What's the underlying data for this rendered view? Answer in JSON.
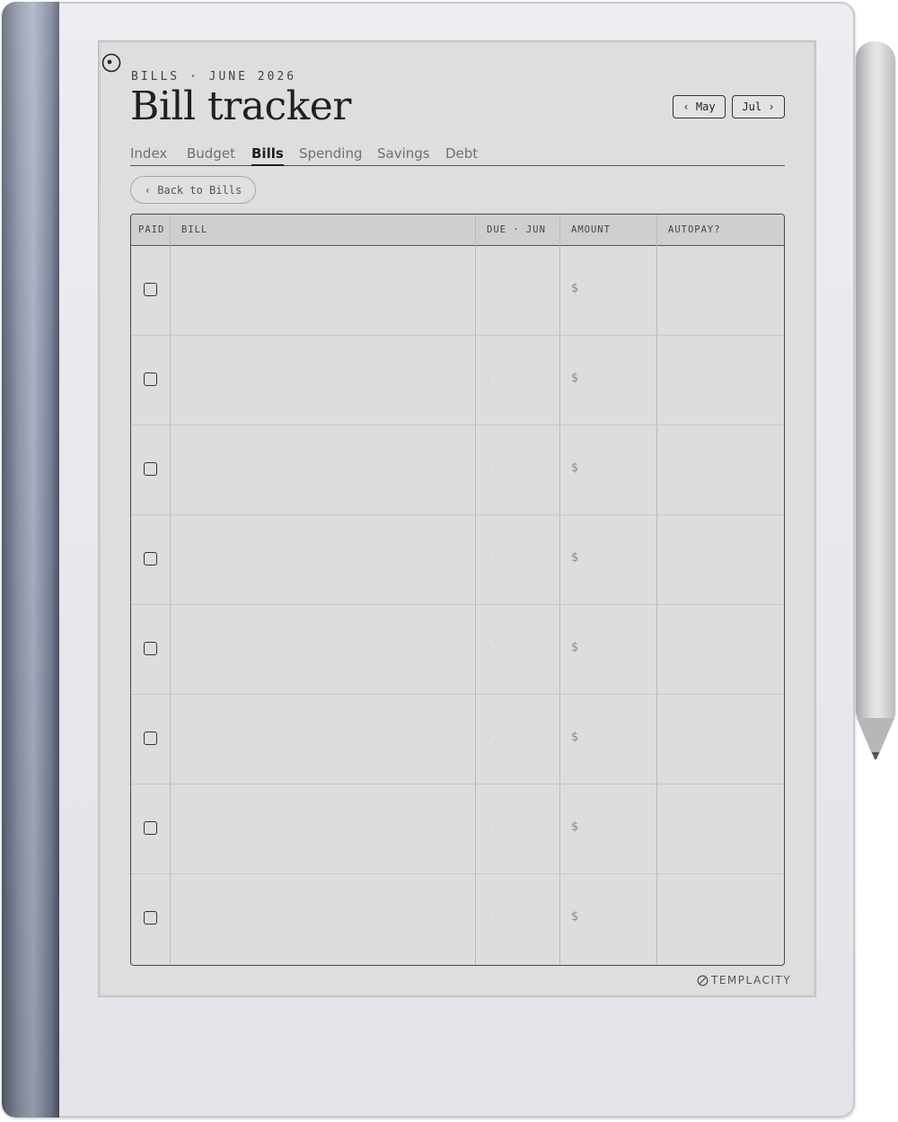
{
  "header": {
    "kicker": "BILLS · JUNE 2026",
    "title": "Bill tracker"
  },
  "month_nav": {
    "prev_label": "‹ May",
    "next_label": "Jul ›"
  },
  "tabs": [
    {
      "label": "Index",
      "active": false
    },
    {
      "label": "Budget",
      "active": false
    },
    {
      "label": "Bills",
      "active": true
    },
    {
      "label": "Spending",
      "active": false
    },
    {
      "label": "Savings",
      "active": false
    },
    {
      "label": "Debt",
      "active": false
    }
  ],
  "back_button": {
    "label": "‹ Back to Bills"
  },
  "table": {
    "columns": [
      "PAID",
      "BILL",
      "DUE · JUN",
      "AMOUNT",
      "AUTOPAY?"
    ],
    "rows": [
      {
        "paid": false,
        "bill": "",
        "due": "·",
        "amount": "$",
        "autopay": ""
      },
      {
        "paid": false,
        "bill": "",
        "due": "·",
        "amount": "$",
        "autopay": ""
      },
      {
        "paid": false,
        "bill": "",
        "due": "·",
        "amount": "$",
        "autopay": ""
      },
      {
        "paid": false,
        "bill": "",
        "due": "·",
        "amount": "$",
        "autopay": ""
      },
      {
        "paid": false,
        "bill": "",
        "due": "·",
        "amount": "$",
        "autopay": ""
      },
      {
        "paid": false,
        "bill": "",
        "due": "·",
        "amount": "$",
        "autopay": ""
      },
      {
        "paid": false,
        "bill": "",
        "due": "·",
        "amount": "$",
        "autopay": ""
      },
      {
        "paid": false,
        "bill": "",
        "due": "·",
        "amount": "$",
        "autopay": ""
      }
    ]
  },
  "footer": {
    "brand": "TEMPLACITY",
    "brand_icon": "templacity-logo-icon"
  },
  "colors": {
    "screen": "#dedede",
    "ink": "#202020",
    "header_bg": "#cfcfcf",
    "spine": "#8f97aa"
  }
}
